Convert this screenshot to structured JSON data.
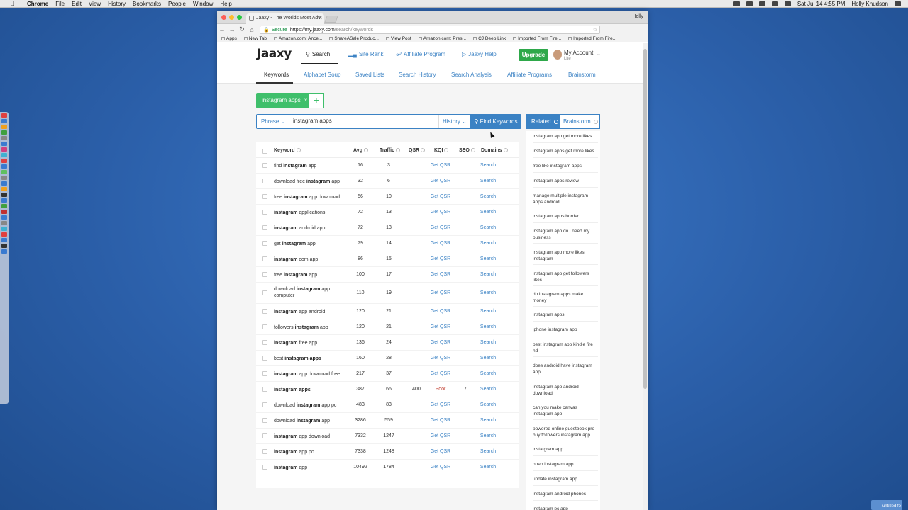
{
  "menubar": {
    "app": "Chrome",
    "items": [
      "File",
      "Edit",
      "View",
      "History",
      "Bookmarks",
      "People",
      "Window",
      "Help"
    ],
    "datetime": "Sat Jul 14  4:55 PM",
    "user": "Holly Knudson"
  },
  "browser": {
    "tab_title": "Jaaxy - The Worlds Most Adv",
    "profile": "Holly",
    "url_secure": "Secure",
    "url_host": "https://my.jaaxy.com",
    "url_path": "/search/keywords",
    "bookmarks": [
      "Apps",
      "New Tab",
      "Amazon.com: Ance...",
      "ShareASale Produc...",
      "View Post",
      "Amazon.com: Pres...",
      "CJ Deep Link",
      "Imported From Fire...",
      "Imported From Fire..."
    ]
  },
  "site": {
    "logo": "Jaaxy",
    "nav": [
      {
        "label": "Search",
        "icon": "search-icon"
      },
      {
        "label": "Site Rank",
        "icon": "bar-chart-icon"
      },
      {
        "label": "Affiliate Program",
        "icon": "share-icon"
      },
      {
        "label": "Jaaxy Help",
        "icon": "play-circle-icon"
      }
    ],
    "upgrade": "Upgrade",
    "account": "My Account",
    "account_sub": "Lite",
    "subnav": [
      "Keywords",
      "Alphabet Soup",
      "Saved Lists",
      "Search History",
      "Search Analysis",
      "Affiliate Programs",
      "Brainstorm"
    ]
  },
  "search": {
    "chip": "instagram apps",
    "mode": "Phrase",
    "query": "instagram apps",
    "history": "History",
    "find_button": "Find Keywords"
  },
  "table": {
    "headers": [
      "Keyword",
      "Avg",
      "Traffic",
      "QSR",
      "KQI",
      "SEO",
      "Domains"
    ],
    "rows": [
      {
        "kw": [
          [
            "find ",
            0
          ],
          [
            "instagram",
            1
          ],
          [
            " app",
            0
          ]
        ],
        "avg": "16",
        "traffic": "3",
        "qsr": "Get QSR",
        "kqi": "",
        "seo": "",
        "domains": "Search"
      },
      {
        "kw": [
          [
            "download free ",
            0
          ],
          [
            "instagram",
            1
          ],
          [
            " app",
            0
          ]
        ],
        "avg": "32",
        "traffic": "6",
        "qsr": "Get QSR",
        "kqi": "",
        "seo": "",
        "domains": "Search"
      },
      {
        "kw": [
          [
            "free ",
            0
          ],
          [
            "instagram",
            1
          ],
          [
            " app download",
            0
          ]
        ],
        "avg": "56",
        "traffic": "10",
        "qsr": "Get QSR",
        "kqi": "",
        "seo": "",
        "domains": "Search"
      },
      {
        "kw": [
          [
            "instagram",
            1
          ],
          [
            " applications",
            0
          ]
        ],
        "avg": "72",
        "traffic": "13",
        "qsr": "Get QSR",
        "kqi": "",
        "seo": "",
        "domains": "Search"
      },
      {
        "kw": [
          [
            "instagram",
            1
          ],
          [
            " android app",
            0
          ]
        ],
        "avg": "72",
        "traffic": "13",
        "qsr": "Get QSR",
        "kqi": "",
        "seo": "",
        "domains": "Search"
      },
      {
        "kw": [
          [
            "get ",
            0
          ],
          [
            "instagram",
            1
          ],
          [
            " app",
            0
          ]
        ],
        "avg": "79",
        "traffic": "14",
        "qsr": "Get QSR",
        "kqi": "",
        "seo": "",
        "domains": "Search"
      },
      {
        "kw": [
          [
            "instagram",
            1
          ],
          [
            " com app",
            0
          ]
        ],
        "avg": "86",
        "traffic": "15",
        "qsr": "Get QSR",
        "kqi": "",
        "seo": "",
        "domains": "Search"
      },
      {
        "kw": [
          [
            "free ",
            0
          ],
          [
            "instagram",
            1
          ],
          [
            " app",
            0
          ]
        ],
        "avg": "100",
        "traffic": "17",
        "qsr": "Get QSR",
        "kqi": "",
        "seo": "",
        "domains": "Search"
      },
      {
        "kw": [
          [
            "download ",
            0
          ],
          [
            "instagram",
            1
          ],
          [
            " app computer",
            0
          ]
        ],
        "avg": "110",
        "traffic": "19",
        "qsr": "Get QSR",
        "kqi": "",
        "seo": "",
        "domains": "Search"
      },
      {
        "kw": [
          [
            "instagram",
            1
          ],
          [
            " app android",
            0
          ]
        ],
        "avg": "120",
        "traffic": "21",
        "qsr": "Get QSR",
        "kqi": "",
        "seo": "",
        "domains": "Search"
      },
      {
        "kw": [
          [
            "followers ",
            0
          ],
          [
            "instagram",
            1
          ],
          [
            " app",
            0
          ]
        ],
        "avg": "120",
        "traffic": "21",
        "qsr": "Get QSR",
        "kqi": "",
        "seo": "",
        "domains": "Search"
      },
      {
        "kw": [
          [
            "instagram",
            1
          ],
          [
            " free app",
            0
          ]
        ],
        "avg": "136",
        "traffic": "24",
        "qsr": "Get QSR",
        "kqi": "",
        "seo": "",
        "domains": "Search"
      },
      {
        "kw": [
          [
            "best ",
            0
          ],
          [
            "instagram apps",
            1
          ]
        ],
        "avg": "160",
        "traffic": "28",
        "qsr": "Get QSR",
        "kqi": "",
        "seo": "",
        "domains": "Search"
      },
      {
        "kw": [
          [
            "instagram",
            1
          ],
          [
            " app download free",
            0
          ]
        ],
        "avg": "217",
        "traffic": "37",
        "qsr": "Get QSR",
        "kqi": "",
        "seo": "",
        "domains": "Search"
      },
      {
        "kw": [
          [
            "instagram apps",
            1
          ]
        ],
        "avg": "387",
        "traffic": "66",
        "qsr": "400",
        "kqi": "Poor",
        "seo": "7",
        "domains": "Search"
      },
      {
        "kw": [
          [
            "download ",
            0
          ],
          [
            "instagram",
            1
          ],
          [
            " app pc",
            0
          ]
        ],
        "avg": "483",
        "traffic": "83",
        "qsr": "Get QSR",
        "kqi": "",
        "seo": "",
        "domains": "Search"
      },
      {
        "kw": [
          [
            "download ",
            0
          ],
          [
            "instagram",
            1
          ],
          [
            " app",
            0
          ]
        ],
        "avg": "3286",
        "traffic": "559",
        "qsr": "Get QSR",
        "kqi": "",
        "seo": "",
        "domains": "Search"
      },
      {
        "kw": [
          [
            "instagram",
            1
          ],
          [
            " app download",
            0
          ]
        ],
        "avg": "7332",
        "traffic": "1247",
        "qsr": "Get QSR",
        "kqi": "",
        "seo": "",
        "domains": "Search"
      },
      {
        "kw": [
          [
            "instagram",
            1
          ],
          [
            " app pc",
            0
          ]
        ],
        "avg": "7338",
        "traffic": "1248",
        "qsr": "Get QSR",
        "kqi": "",
        "seo": "",
        "domains": "Search"
      },
      {
        "kw": [
          [
            "instagram",
            1
          ],
          [
            " app",
            0
          ]
        ],
        "avg": "10492",
        "traffic": "1784",
        "qsr": "Get QSR",
        "kqi": "",
        "seo": "",
        "domains": "Search"
      }
    ]
  },
  "related": {
    "tabs": [
      "Related",
      "Brainstorm"
    ],
    "items": [
      "instagram app get more likes",
      "instagram apps get more likes",
      "free like instagram apps",
      "instagram apps review",
      "manage multiple instagram apps android",
      "instagram apps border",
      "instagram app do i need my business",
      "instagram app more likes instagram",
      "instagram app get followers likes",
      "do instagram apps make money",
      "instagram apps",
      "iphone instagram app",
      "best instagram app kindle fire hd",
      "does android have instagram app",
      "instagram app android download",
      "can you make canvas instagram app",
      "powered online guestbook pro buy followers instagram app",
      "insta gram app",
      "open instagram app",
      "update instagram app",
      "instagram android phones",
      "instagram pc app"
    ]
  },
  "desktop_label": "untitled fo"
}
